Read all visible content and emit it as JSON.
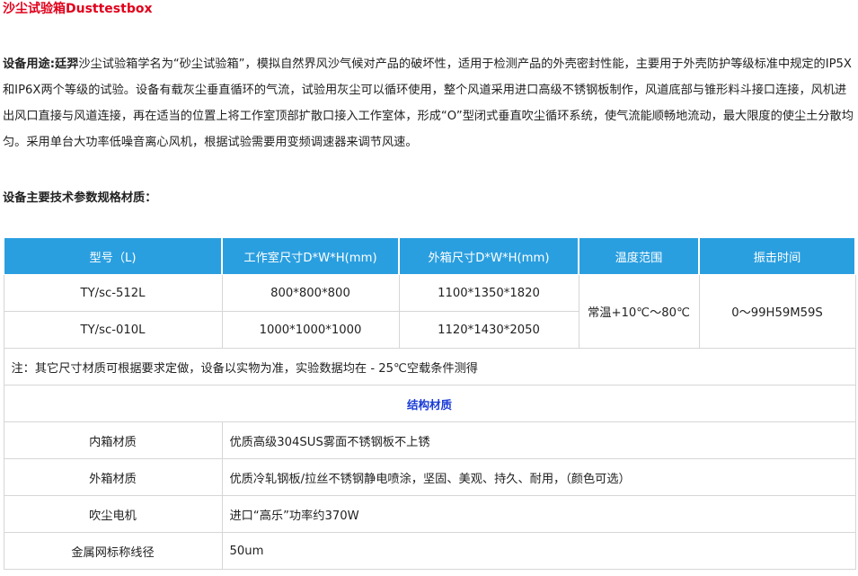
{
  "title": "沙尘试验箱Dusttestbox",
  "description": {
    "label": "设备用途:廷羿",
    "text": "沙尘试验箱学名为“砂尘试验箱”，模拟自然界风沙气候对产品的破坏性，适用于检测产品的外壳密封性能，主要用于外壳防护等级标准中规定的IP5X和IP6X两个等级的试验。设备有载灰尘垂直循环的气流，试验用灰尘可以循环使用，整个风道采用进口高级不锈钢板制作，风道底部与锥形料斗接口连接，风机进出风口直接与风道连接，再在适当的位置上将工作室顶部扩散口接入工作室体，形成“O”型闭式垂直吹尘循环系统，使气流能顺畅地流动，最大限度的使尘土分散均匀。采用单台大功率低噪音离心风机，根据试验需要用变频调速器来调节风速。"
  },
  "spec_heading": "设备主要技术参数规格材质：",
  "table": {
    "headers": [
      "型号（L)",
      "工作室尺寸D*W*H(mm)",
      "外箱尺寸D*W*H(mm)",
      "温度范围",
      "振击时间"
    ],
    "rows": [
      {
        "model": "TY/sc-512L",
        "inner": "800*800*800",
        "outer": "1100*1350*1820"
      },
      {
        "model": "TY/sc-010L",
        "inner": "1000*1000*1000",
        "outer": "1120*1430*2050"
      }
    ],
    "temp_range": "常温+10℃～80℃",
    "shock_time": "0～99H59M59S",
    "note": "注：其它尺寸材质可根据要求定做，设备以实物为准，实验数据均在 - 25℃空载条件测得",
    "section_title": "结构材质",
    "materials": [
      {
        "name": "内箱材质",
        "value": "优质高级304SUS雾面不锈钢板不上锈"
      },
      {
        "name": "外箱材质",
        "value": "优质冷轧钢板/拉丝不锈钢静电喷涂，坚固、美观、持久、耐用，（颜色可选）"
      },
      {
        "name": "吹尘电机",
        "value": "进口“高乐”功率约370W"
      },
      {
        "name": "金属网标称线径",
        "value": "50um"
      }
    ]
  },
  "colors": {
    "title": "#e0001b",
    "header_bg": "#2a9fe0",
    "section_title": "#1a3cd6"
  }
}
